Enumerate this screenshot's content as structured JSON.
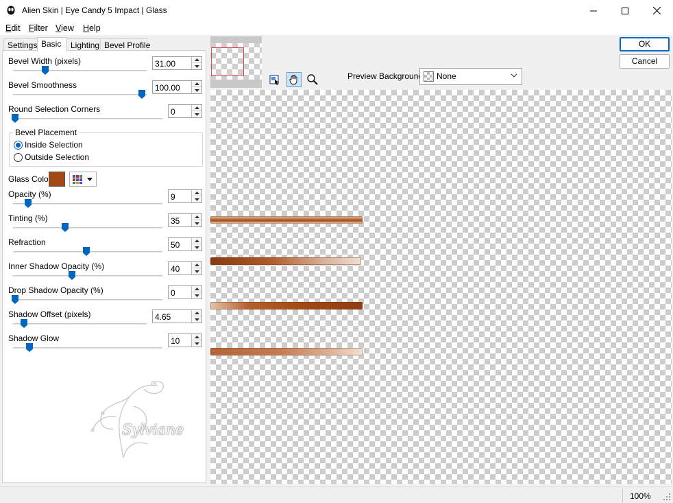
{
  "window": {
    "title": "Alien Skin | Eye Candy 5 Impact | Glass"
  },
  "menu": [
    {
      "label": "Edit",
      "u": "E",
      "rest": "dit"
    },
    {
      "label": "Filter",
      "u": "F",
      "rest": "ilter"
    },
    {
      "label": "View",
      "u": "V",
      "rest": "iew"
    },
    {
      "label": "Help",
      "u": "H",
      "rest": "elp"
    }
  ],
  "tabs": [
    "Settings",
    "Basic",
    "Lighting",
    "Bevel Profile"
  ],
  "active_tab": "Basic",
  "controls": {
    "bevel_width": {
      "label": "Bevel Width (pixels)",
      "value": "31.00",
      "fraction": 0.24
    },
    "bevel_smoothness": {
      "label": "Bevel Smoothness",
      "value": "100.00",
      "fraction": 1.0
    },
    "round_corners": {
      "label": "Round Selection Corners",
      "value": "0",
      "fraction": 0.0
    },
    "bevel_placement": {
      "title": "Bevel Placement",
      "options": [
        "Inside Selection",
        "Outside Selection"
      ],
      "selected": "Inside Selection"
    },
    "glass_color": {
      "label": "Glass Color",
      "color": "#a34a14"
    },
    "opacity": {
      "label": "Opacity (%)",
      "value": "9",
      "fraction": 0.09
    },
    "tinting": {
      "label": "Tinting (%)",
      "value": "35",
      "fraction": 0.35
    },
    "refraction": {
      "label": "Refraction",
      "value": "50",
      "fraction": 0.5
    },
    "inner_shadow": {
      "label": "Inner Shadow Opacity (%)",
      "value": "40",
      "fraction": 0.4
    },
    "drop_shadow": {
      "label": "Drop Shadow Opacity (%)",
      "value": "0",
      "fraction": 0.0
    },
    "shadow_offset": {
      "label": "Shadow Offset (pixels)",
      "value": "4.65",
      "fraction": 0.07
    },
    "shadow_glow": {
      "label": "Shadow Glow",
      "value": "10",
      "fraction": 0.1
    }
  },
  "preview": {
    "background_label": "Preview Background:",
    "background_value": "None",
    "tools": [
      "navigate-preview-icon",
      "hand-pan-icon",
      "zoom-icon"
    ]
  },
  "buttons": {
    "ok": "OK",
    "cancel": "Cancel"
  },
  "status": {
    "zoom": "100%"
  },
  "watermark_text": "Sylviane",
  "colors": {
    "accent": "#005fb8",
    "glass": "#a34a14",
    "thumbnail_frame": "#e2474c"
  }
}
